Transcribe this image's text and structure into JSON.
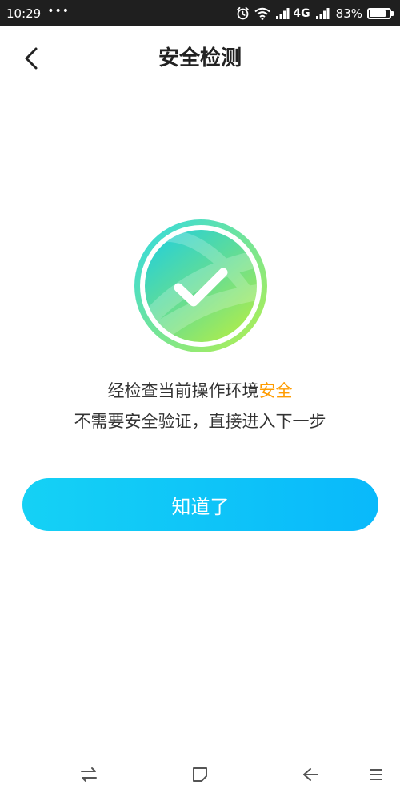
{
  "status_bar": {
    "time": "10:29",
    "dots": "•••",
    "network": "4G",
    "battery_percent": "83%",
    "battery_level": 0.83
  },
  "header": {
    "title": "安全检测"
  },
  "message": {
    "line1_prefix": "经检查当前操作环境",
    "line1_highlight": "安全",
    "line2": "不需要安全验证，直接进入下一步"
  },
  "actions": {
    "ok_label": "知道了"
  },
  "colors": {
    "accent": "#09b9fb",
    "highlight": "#ff9c00",
    "emblem_start": "#2ed9e5",
    "emblem_end": "#b8f04a"
  },
  "icons": {
    "back": "chevron-left-icon",
    "emblem": "check-circle-icon",
    "nav_switch": "switch-arrows-icon",
    "nav_home": "square-icon",
    "nav_back": "back-arrow-icon",
    "nav_menu": "menu-icon"
  }
}
